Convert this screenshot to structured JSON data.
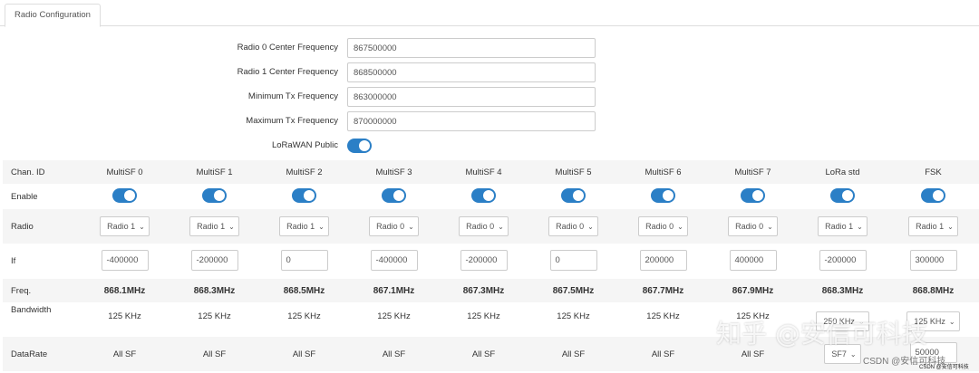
{
  "tab": {
    "label": "Radio Configuration"
  },
  "form": {
    "radio0_label": "Radio 0 Center Frequency",
    "radio0_value": "867500000",
    "radio1_label": "Radio 1 Center Frequency",
    "radio1_value": "868500000",
    "min_tx_label": "Minimum Tx Frequency",
    "min_tx_value": "863000000",
    "max_tx_label": "Maximum Tx Frequency",
    "max_tx_value": "870000000",
    "lorawan_public_label": "LoRaWAN Public",
    "lorawan_public_on": true
  },
  "grid": {
    "row_labels": {
      "chan_id": "Chan. ID",
      "enable": "Enable",
      "radio": "Radio",
      "if": "If",
      "freq": "Freq.",
      "bandwidth": "Bandwidth",
      "datarate": "DataRate"
    },
    "channels": [
      {
        "id": "MultiSF 0",
        "enabled": true,
        "radio": "Radio 1",
        "if": "-400000",
        "freq": "868.1MHz",
        "bandwidth": "125 KHz",
        "datarate": "All SF"
      },
      {
        "id": "MultiSF 1",
        "enabled": true,
        "radio": "Radio 1",
        "if": "-200000",
        "freq": "868.3MHz",
        "bandwidth": "125 KHz",
        "datarate": "All SF"
      },
      {
        "id": "MultiSF 2",
        "enabled": true,
        "radio": "Radio 1",
        "if": "0",
        "freq": "868.5MHz",
        "bandwidth": "125 KHz",
        "datarate": "All SF"
      },
      {
        "id": "MultiSF 3",
        "enabled": true,
        "radio": "Radio 0",
        "if": "-400000",
        "freq": "867.1MHz",
        "bandwidth": "125 KHz",
        "datarate": "All SF"
      },
      {
        "id": "MultiSF 4",
        "enabled": true,
        "radio": "Radio 0",
        "if": "-200000",
        "freq": "867.3MHz",
        "bandwidth": "125 KHz",
        "datarate": "All SF"
      },
      {
        "id": "MultiSF 5",
        "enabled": true,
        "radio": "Radio 0",
        "if": "0",
        "freq": "867.5MHz",
        "bandwidth": "125 KHz",
        "datarate": "All SF"
      },
      {
        "id": "MultiSF 6",
        "enabled": true,
        "radio": "Radio 0",
        "if": "200000",
        "freq": "867.7MHz",
        "bandwidth": "125 KHz",
        "datarate": "All SF"
      },
      {
        "id": "MultiSF 7",
        "enabled": true,
        "radio": "Radio 0",
        "if": "400000",
        "freq": "867.9MHz",
        "bandwidth": "125 KHz",
        "datarate": "All SF"
      },
      {
        "id": "LoRa std",
        "enabled": true,
        "radio": "Radio 1",
        "if": "-200000",
        "freq": "868.3MHz",
        "bandwidth": "250 KHz",
        "datarate": "SF7"
      },
      {
        "id": "FSK",
        "enabled": true,
        "radio": "Radio 1",
        "if": "300000",
        "freq": "868.8MHz",
        "bandwidth": "125 KHz",
        "datarate": "50000"
      }
    ]
  },
  "watermark": {
    "text": "知乎 @安信可科技",
    "csdn": "CSDN @安信可科技",
    "csdn_small": "CSDN @安信可科技"
  },
  "colors": {
    "toggle_on": "#2b7fc6",
    "row_alt": "#f5f5f5",
    "border": "#cccccc"
  },
  "icons": {
    "select_arrow": "chevron-down-icon"
  }
}
